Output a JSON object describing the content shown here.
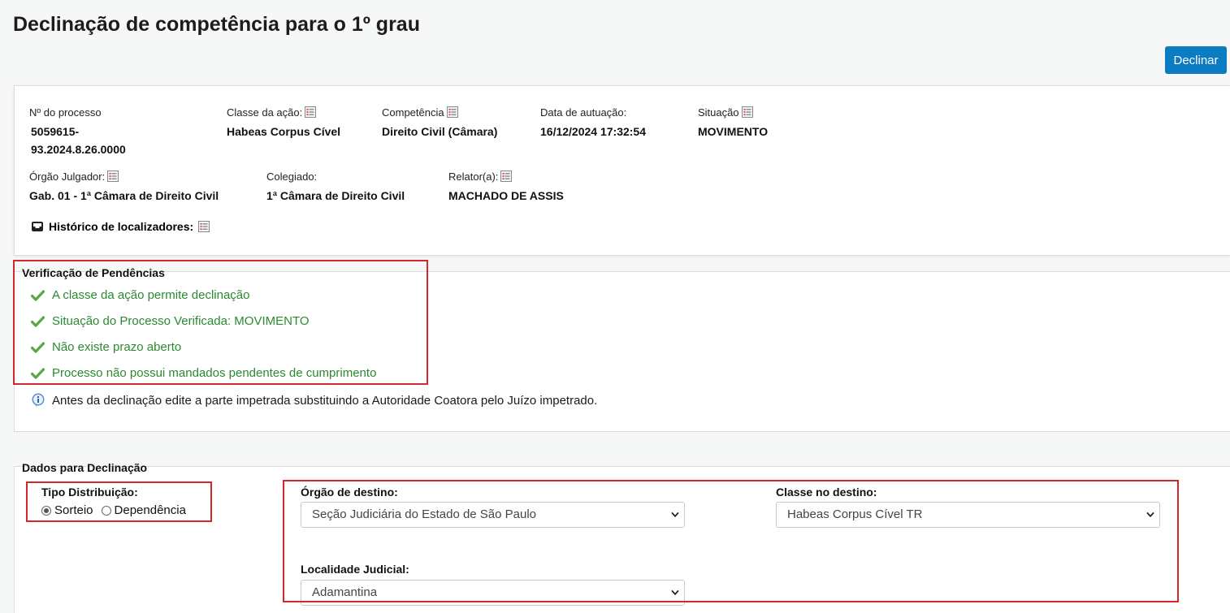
{
  "page": {
    "title": "Declinação de competência para o 1º grau"
  },
  "toolbar": {
    "declinar_label": "Declinar"
  },
  "processo": {
    "numero_label": "Nº do processo",
    "numero_line1": "5059615-",
    "numero_line2": "93.2024.8.26.0000",
    "classe_label": "Classe da ação:",
    "classe_value": "Habeas Corpus Cível",
    "competencia_label": "Competência",
    "competencia_value": "Direito Civil (Câmara)",
    "data_label": "Data de autuação:",
    "data_value": "16/12/2024 17:32:54",
    "situacao_label": "Situação",
    "situacao_value": "MOVIMENTO",
    "orgao_label": "Órgão Julgador:",
    "orgao_value": "Gab. 01 - 1ª Câmara de Direito Civil",
    "colegiado_label": "Colegiado:",
    "colegiado_value": "1ª Câmara de Direito Civil",
    "relator_label": "Relator(a):",
    "relator_value": "MACHADO DE ASSIS",
    "historico_label": "Histórico de localizadores:"
  },
  "pendencias": {
    "title": "Verificação de Pendências",
    "items": [
      "A classe da ação permite declinação",
      "Situação do Processo Verificada: MOVIMENTO",
      "Não existe prazo aberto",
      "Processo não possui mandados pendentes de cumprimento"
    ],
    "info": "Antes da declinação edite a parte impetrada substituindo a Autoridade Coatora pelo Juízo impetrado."
  },
  "dados": {
    "title": "Dados para Declinação",
    "tipo_label": "Tipo Distribuição:",
    "tipo_options": [
      "Sorteio",
      "Dependência"
    ],
    "tipo_selected": "Sorteio",
    "orgao_destino_label": "Órgão de destino:",
    "orgao_destino_value": "Seção Judiciária do Estado de São Paulo",
    "classe_destino_label": "Classe no destino:",
    "classe_destino_value": "Habeas Corpus Cível TR",
    "localidade_label": "Localidade Judicial:",
    "localidade_value": "Adamantina"
  },
  "colors": {
    "accent": "#0b7cc1",
    "success": "#2b8a2e",
    "highlight": "#d6262d"
  }
}
